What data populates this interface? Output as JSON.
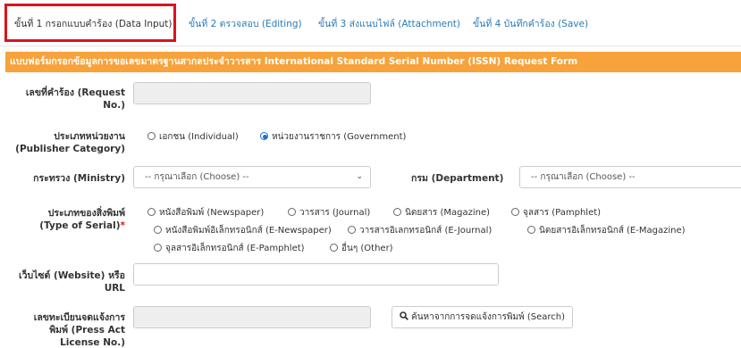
{
  "tabs": [
    {
      "label": "ขั้นที่ 1 กรอกแบบคำร้อง (Data Input)",
      "active": true
    },
    {
      "label": "ขั้นที่ 2 ตรวจสอบ (Editing)",
      "active": false
    },
    {
      "label": "ขั้นที่ 3 ส่งแนบไฟล์ (Attachment)",
      "active": false
    },
    {
      "label": "ขั้นที่ 4 บันทึกคำร้อง (Save)",
      "active": false
    }
  ],
  "form": {
    "title": "แบบฟอร์มกรอกข้อมูลการขอเลขมาตรฐานสากลประจำวารสาร International Standard Serial Number (ISSN) Request Form",
    "request_no": {
      "label_1": "เลขที่คำร้อง (Request",
      "label_2": "No.)",
      "value": ""
    },
    "publisher_category": {
      "label_1": "ประเภทหน่วยงาน",
      "label_2": "(Publisher Category)",
      "options": [
        "เอกชน (Individual)",
        "หน่วยงานราชการ (Government)"
      ],
      "selected": "หน่วยงานราชการ (Government)"
    },
    "ministry": {
      "label": "กระทรวง (Ministry)",
      "placeholder": "-- กรุณาเลือก (Choose) --"
    },
    "department": {
      "label": "กรม (Department)",
      "placeholder": "-- กรุณาเลือก (Choose) --"
    },
    "type_of_serial": {
      "label_1": "ประเภทของสิ่งพิมพ์",
      "label_2": "(Type of Serial)",
      "required_mark": "*",
      "options_row1": [
        "หนังสือพิมพ์ (Newspaper)",
        "วารสาร (Journal)",
        "นิตยสาร (Magazine)",
        "จุลสาร (Pamphlet)"
      ],
      "options_row2": [
        "หนังสือพิมพ์อิเล็กทรอนิกส์ (E-Newspaper)",
        "วารสารอิเลกทรอนิกส์ (E-Journal)",
        "นิตยสารอิเล็กทรอนิกส์ (E-Magazine)"
      ],
      "options_row3": [
        "จุลสารอิเล็กทรอนิกส์ (E-Pamphlet)",
        "อื่นๆ (Other)"
      ]
    },
    "website": {
      "label_1": "เว็บไซต์ (Website) หรือ",
      "label_2": "URL",
      "value": ""
    },
    "press_act": {
      "label_1": "เลขทะเบียนจดแจ้งการ",
      "label_2": "พิมพ์ (Press Act",
      "label_3": "License No.)",
      "value": "",
      "search_label": "ค้นหาจากการจดแจ้งการพิมพ์ (Search)",
      "search_icon": "search-icon"
    }
  }
}
